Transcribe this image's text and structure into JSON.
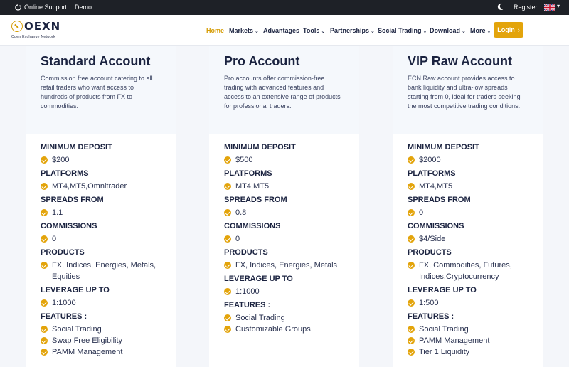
{
  "topbar": {
    "online_support": "Online Support",
    "demo": "Demo",
    "register": "Register"
  },
  "header": {
    "logo_word": "OEXN",
    "logo_tagline": "Open Exchange Network",
    "nav": [
      "Home",
      "Markets",
      "Advantages",
      "Tools",
      "Partnerships",
      "Social Trading",
      "Download",
      "More"
    ],
    "login": "Login",
    "accent": "#e3a40b"
  },
  "accounts": [
    {
      "title": "Standard Account",
      "description": "Commission free account catering to all retail traders who want access to hundreds of products from FX to commodities.",
      "min_deposit_label": "MINIMUM DEPOSIT",
      "min_deposit": "$200",
      "platforms_label": "PLATFORMS",
      "platforms": "MT4,MT5,Omnitrader",
      "spreads_label": "SPREADS FROM",
      "spreads": "1.1",
      "commissions_label": "COMMISSIONS",
      "commissions": "0",
      "products_label": "PRODUCTS",
      "products": "FX, Indices, Energies, Metals, Equities",
      "leverage_label": "LEVERAGE UP TO",
      "leverage": "1:1000",
      "features_label": "FEATURES :",
      "features": [
        "Social Trading",
        "Swap Free Eligibility",
        "PAMM Management"
      ]
    },
    {
      "title": "Pro Account",
      "description": "Pro accounts offer commission-free trading with advanced features and access to an extensive range of products for professional traders.",
      "min_deposit_label": "MINIMUM DEPOSIT",
      "min_deposit": "$500",
      "platforms_label": "PLATFORMS",
      "platforms": "MT4,MT5",
      "spreads_label": "SPREADS FROM",
      "spreads": "0.8",
      "commissions_label": "COMMISSIONS",
      "commissions": "0",
      "products_label": "PRODUCTS",
      "products": "FX, Indices, Energies, Metals",
      "leverage_label": "LEVERAGE UP TO",
      "leverage": "1:1000",
      "features_label": "FEATURES :",
      "features": [
        "Social Trading",
        "Customizable Groups"
      ]
    },
    {
      "title": "VIP Raw Account",
      "description": "ECN Raw account provides access to bank liquidity and ultra-low spreads starting from 0, ideal for traders seeking the most competitive trading conditions.",
      "min_deposit_label": "MINIMUM DEPOSIT",
      "min_deposit": "$2000",
      "platforms_label": "PLATFORMS",
      "platforms": "MT4,MT5",
      "spreads_label": "SPREADS FROM",
      "spreads": "0",
      "commissions_label": "COMMISSIONS",
      "commissions": "$4/Side",
      "products_label": "PRODUCTS",
      "products": "FX, Commodities, Futures, Indices,Cryptocurrency",
      "leverage_label": "LEVERAGE UP TO",
      "leverage": "1:500",
      "features_label": "FEATURES :",
      "features": [
        "Social Trading",
        "PAMM Management",
        "Tier 1 Liquidity"
      ]
    }
  ]
}
